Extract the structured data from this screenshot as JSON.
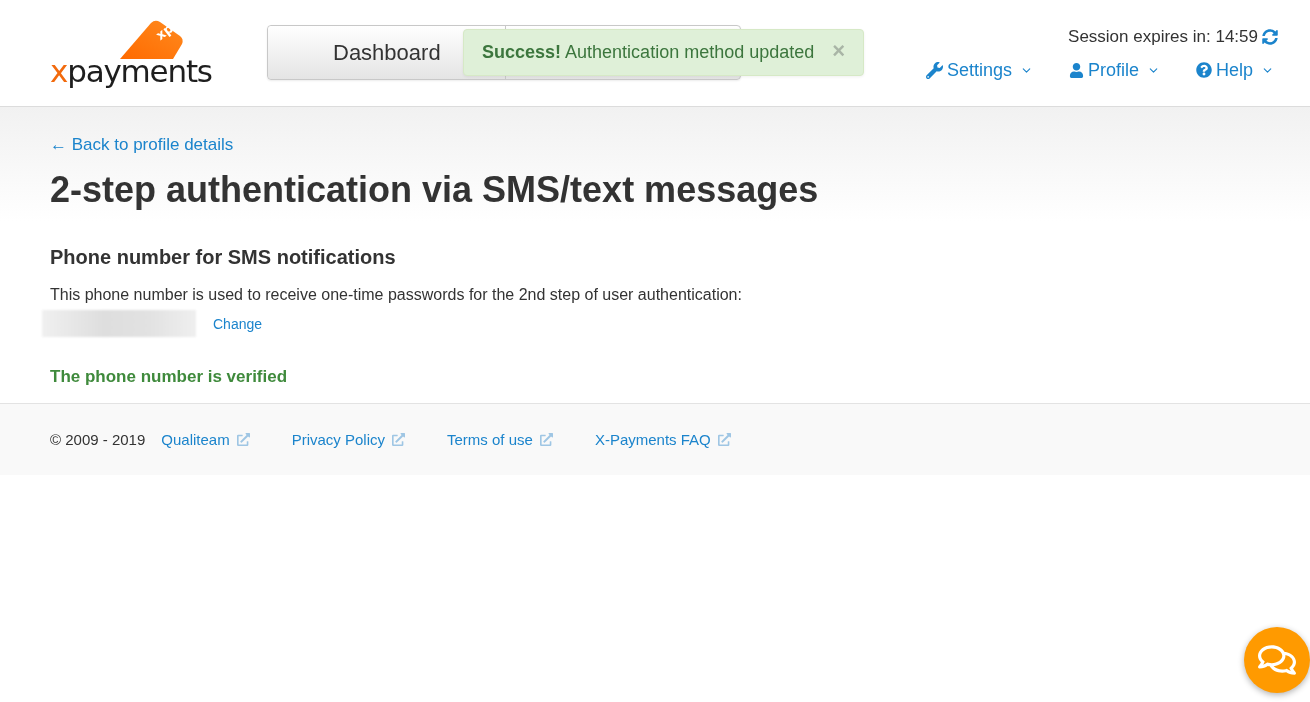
{
  "header": {
    "logo": {
      "accent": "x",
      "word": "payments",
      "tag": "xp"
    },
    "nav": [
      {
        "label": "Dashboard"
      }
    ],
    "alert": {
      "kind": "success",
      "message": "**Success!** Authentication method updated",
      "close": "×"
    },
    "session": "Session expires in: 14:59",
    "menus": [
      {
        "kind": "settings",
        "label": "Settings"
      },
      {
        "kind": "profile",
        "label": "Profile"
      },
      {
        "kind": "help",
        "label": "Help"
      }
    ]
  },
  "content": {
    "back_link": "← Back to profile details",
    "title": "2-step authentication via SMS/text messages",
    "section_heading": "Phone number for SMS notifications",
    "description": "This phone number is used to receive one-time passwords for the 2nd step of user authentication:",
    "change_link": "Change",
    "status": {
      "text": "The phone number is verified",
      "verified": true
    }
  },
  "footer": {
    "copyright": "© 2009 - 2019",
    "links": [
      {
        "label": "Qualiteam",
        "external": true
      },
      {
        "label": "Privacy Policy",
        "external": true
      },
      {
        "label": "Terms of use",
        "external": true
      },
      {
        "label": "X-Payments FAQ",
        "external": true
      }
    ]
  }
}
